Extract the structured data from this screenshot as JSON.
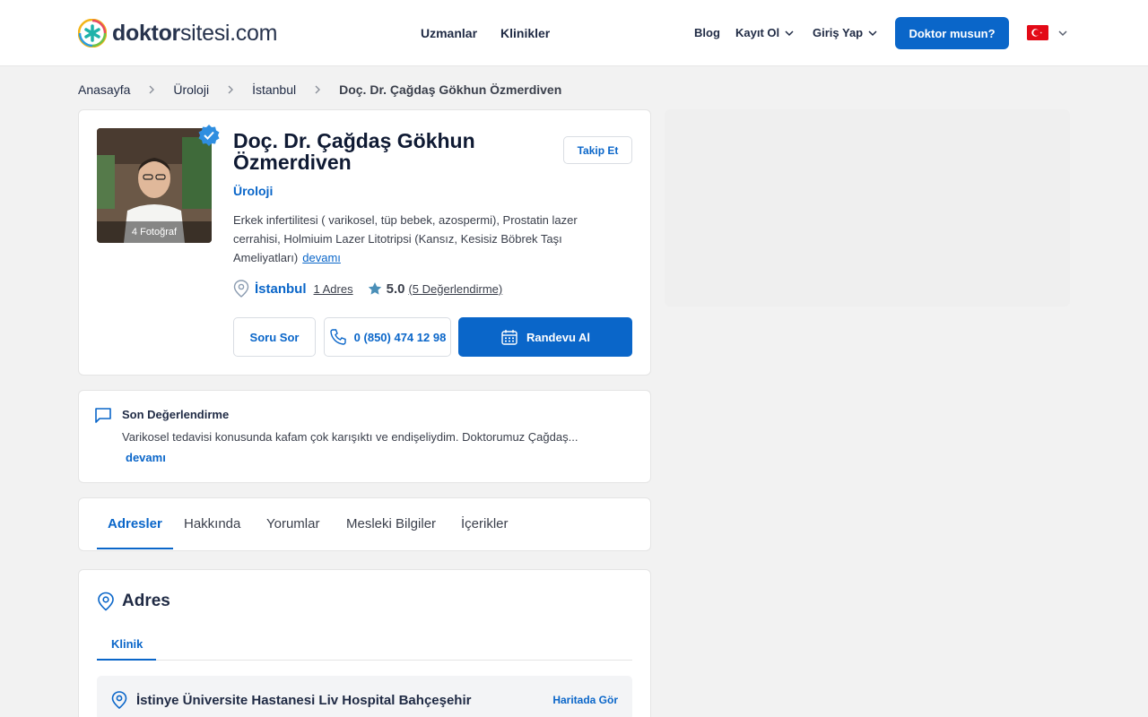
{
  "header": {
    "logo_bold": "doktor",
    "logo_rest": "sitesi.com",
    "nav_center": [
      "Uzmanlar",
      "Klinikler"
    ],
    "blog": "Blog",
    "register": "Kayıt Ol",
    "login": "Giriş Yap",
    "doctor_cta": "Doktor musun?",
    "language_icon": "turkey-flag-icon"
  },
  "breadcrumb": [
    "Anasayfa",
    "Üroloji",
    "İstanbul",
    "Doç. Dr. Çağdaş Gökhun Özmerdiven"
  ],
  "profile": {
    "photo_label": "4 Fotoğraf",
    "name": "Doç. Dr. Çağdaş Gökhun Özmerdiven",
    "follow": "Takip Et",
    "specialty": "Üroloji",
    "description": "Erkek infertilitesi ( varikosel, tüp bebek, azospermi), Prostatin lazer cerrahisi, Holmiuim Lazer Litotripsi (Kansız, Kesisiz Böbrek Taşı Ameliyatları)",
    "more": "devamı",
    "city": "İstanbul",
    "address_count": "1 Adres",
    "rating": "5.0",
    "reviews": "(5 Değerlendirme)",
    "ask_question": "Soru Sor",
    "phone": "0 (850) 474 12 98",
    "appointment": "Randevu Al"
  },
  "latest_review": {
    "title": "Son Değerlendirme",
    "text": "Varikosel tedavisi konusunda kafam çok karışıktı ve endişeliydim. Doktorumuz Çağdaş...",
    "more": "devamı"
  },
  "tabs": [
    "Adresler",
    "Hakkında",
    "Yorumlar",
    "Mesleki Bilgiler",
    "İçerikler"
  ],
  "active_tab": "Adresler",
  "address": {
    "title": "Adres",
    "subtab": "Klinik",
    "clinic_name": "İstinye Üniversite Hastanesi Liv Hospital Bahçeşehir",
    "map_link": "Haritada Gör"
  },
  "colors": {
    "primary": "#0a66c9",
    "text": "#1f2a44",
    "background": "#f2f2f2"
  }
}
